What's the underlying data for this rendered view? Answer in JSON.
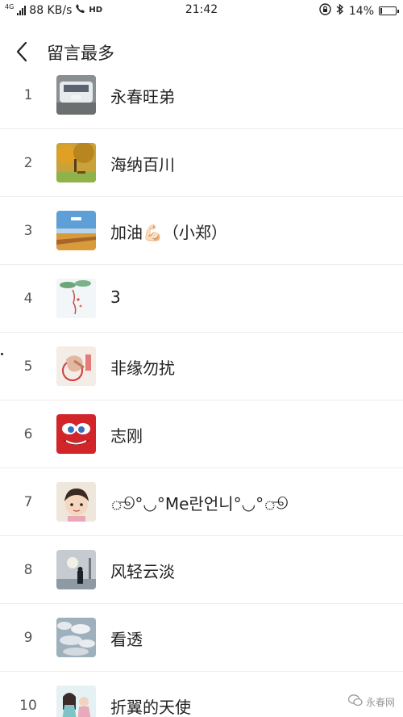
{
  "statusbar": {
    "network": "4G",
    "speed": "88 KB/s",
    "hd": "HD",
    "time": "21:42",
    "battery": "14%",
    "battery_level": 0.14
  },
  "header": {
    "title": "留言最多"
  },
  "rows": [
    {
      "rank": "1",
      "name": "永春旺弟"
    },
    {
      "rank": "2",
      "name": "海纳百川"
    },
    {
      "rank": "3",
      "name": "加油💪🏻（小郑）"
    },
    {
      "rank": "4",
      "name": "3"
    },
    {
      "rank": "5",
      "name": "非缘勿扰"
    },
    {
      "rank": "6",
      "name": "志刚"
    },
    {
      "rank": "7",
      "name": "ூ°◡°Me란언니°◡°ூ"
    },
    {
      "rank": "8",
      "name": "风轻云淡"
    },
    {
      "rank": "9",
      "name": "看透"
    },
    {
      "rank": "10",
      "name": "折翼的天使"
    }
  ],
  "watermark": {
    "label": "永春网"
  }
}
